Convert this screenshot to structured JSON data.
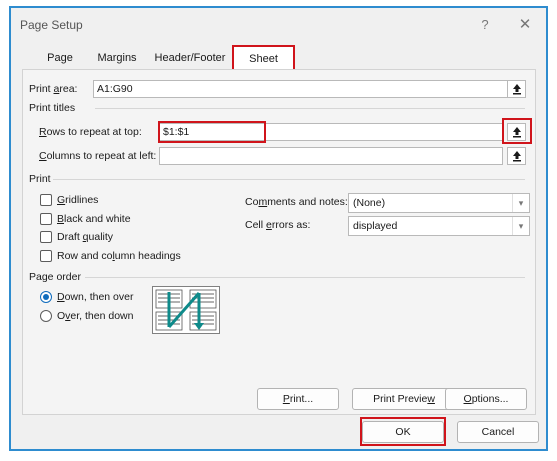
{
  "window": {
    "title": "Page Setup",
    "help_glyph": "?",
    "close_glyph": "✕"
  },
  "tabs": [
    {
      "label": "Page"
    },
    {
      "label": "Margins"
    },
    {
      "label": "Header/Footer"
    },
    {
      "label": "Sheet"
    }
  ],
  "print_area": {
    "label_pre": "Print ",
    "label_ul": "a",
    "label_post": "rea:",
    "value": "A1:G90"
  },
  "print_titles": {
    "heading": "Print titles",
    "rows_label_ul": "R",
    "rows_label_post": "ows to repeat at top:",
    "rows_value": "$1:$1",
    "cols_label_ul": "C",
    "cols_label_post": "olumns to repeat at left:",
    "cols_value": ""
  },
  "print": {
    "heading": "Print",
    "gridlines": {
      "ul": "G",
      "post": "ridlines",
      "checked": false
    },
    "black_white": {
      "ul": "B",
      "post": "lack and white",
      "checked": false
    },
    "draft": {
      "pre": "Draft ",
      "ul": "q",
      "post": "uality",
      "checked": false
    },
    "headings": {
      "pre": "Row and co",
      "ul": "l",
      "post": "umn headings",
      "checked": false
    },
    "comments": {
      "pre": "Co",
      "ul": "m",
      "post": "ments and notes:",
      "value": "(None)"
    },
    "errors": {
      "pre": "Cell ",
      "ul": "e",
      "post": "rrors as:",
      "value": "displayed"
    }
  },
  "page_order": {
    "heading": "Page order",
    "down_over": {
      "ul": "D",
      "post": "own, then over",
      "selected": true
    },
    "over_down": {
      "pre": "O",
      "ul": "v",
      "post": "er, then down",
      "selected": false
    }
  },
  "buttons": {
    "print": {
      "ul": "P",
      "post": "rint..."
    },
    "preview": {
      "pre": "Print Previe",
      "ul": "w",
      "post": ""
    },
    "options": {
      "ul": "O",
      "post": "ptions..."
    },
    "ok": "OK",
    "cancel": "Cancel"
  },
  "colors": {
    "accent": "#0f6cbd",
    "highlight": "#d0141b",
    "frame": "#2e8ccf",
    "preview_arrow": "#0e8a8a"
  }
}
